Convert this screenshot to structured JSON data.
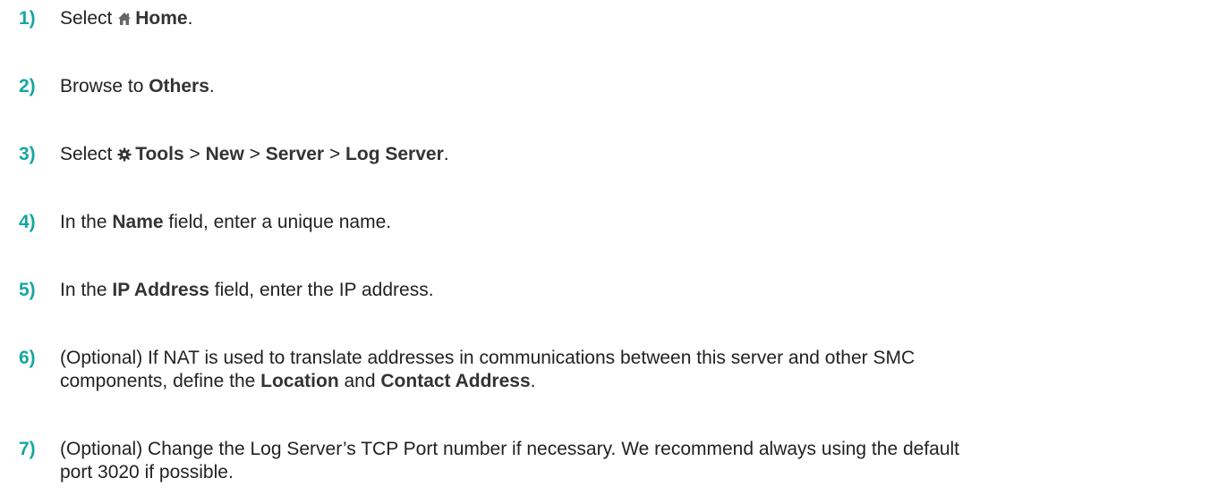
{
  "steps": [
    {
      "num": "1)",
      "parts": {
        "a": "Select ",
        "icon": "home-icon",
        "b": "Home",
        "c": "."
      }
    },
    {
      "num": "2)",
      "parts": {
        "a": "Browse to ",
        "b": "Others",
        "c": "."
      }
    },
    {
      "num": "3)",
      "parts": {
        "a": "Select ",
        "icon": "gear-icon",
        "b1": "Tools",
        "s1": " > ",
        "b2": "New",
        "s2": " > ",
        "b3": "Server",
        "s3": " > ",
        "b4": "Log Server",
        "c": "."
      }
    },
    {
      "num": "4)",
      "parts": {
        "a": "In the ",
        "b": "Name",
        "c": " field, enter a unique name."
      }
    },
    {
      "num": "5)",
      "parts": {
        "a": "In the ",
        "b": "IP Address",
        "c": " field, enter the IP address."
      }
    },
    {
      "num": "6)",
      "parts": {
        "line1": "(Optional) If NAT is used to translate addresses in communications between this server and other SMC",
        "a": "components, define the ",
        "b1": "Location",
        "s1": " and ",
        "b2": "Contact Address",
        "c": "."
      }
    },
    {
      "num": "7)",
      "parts": {
        "line1": "(Optional) Change the Log Server’s TCP Port number if necessary. We recommend always using the default",
        "line2": "port 3020 if possible."
      }
    }
  ],
  "colors": {
    "step_number": "#17a6a0",
    "text": "#222222"
  }
}
